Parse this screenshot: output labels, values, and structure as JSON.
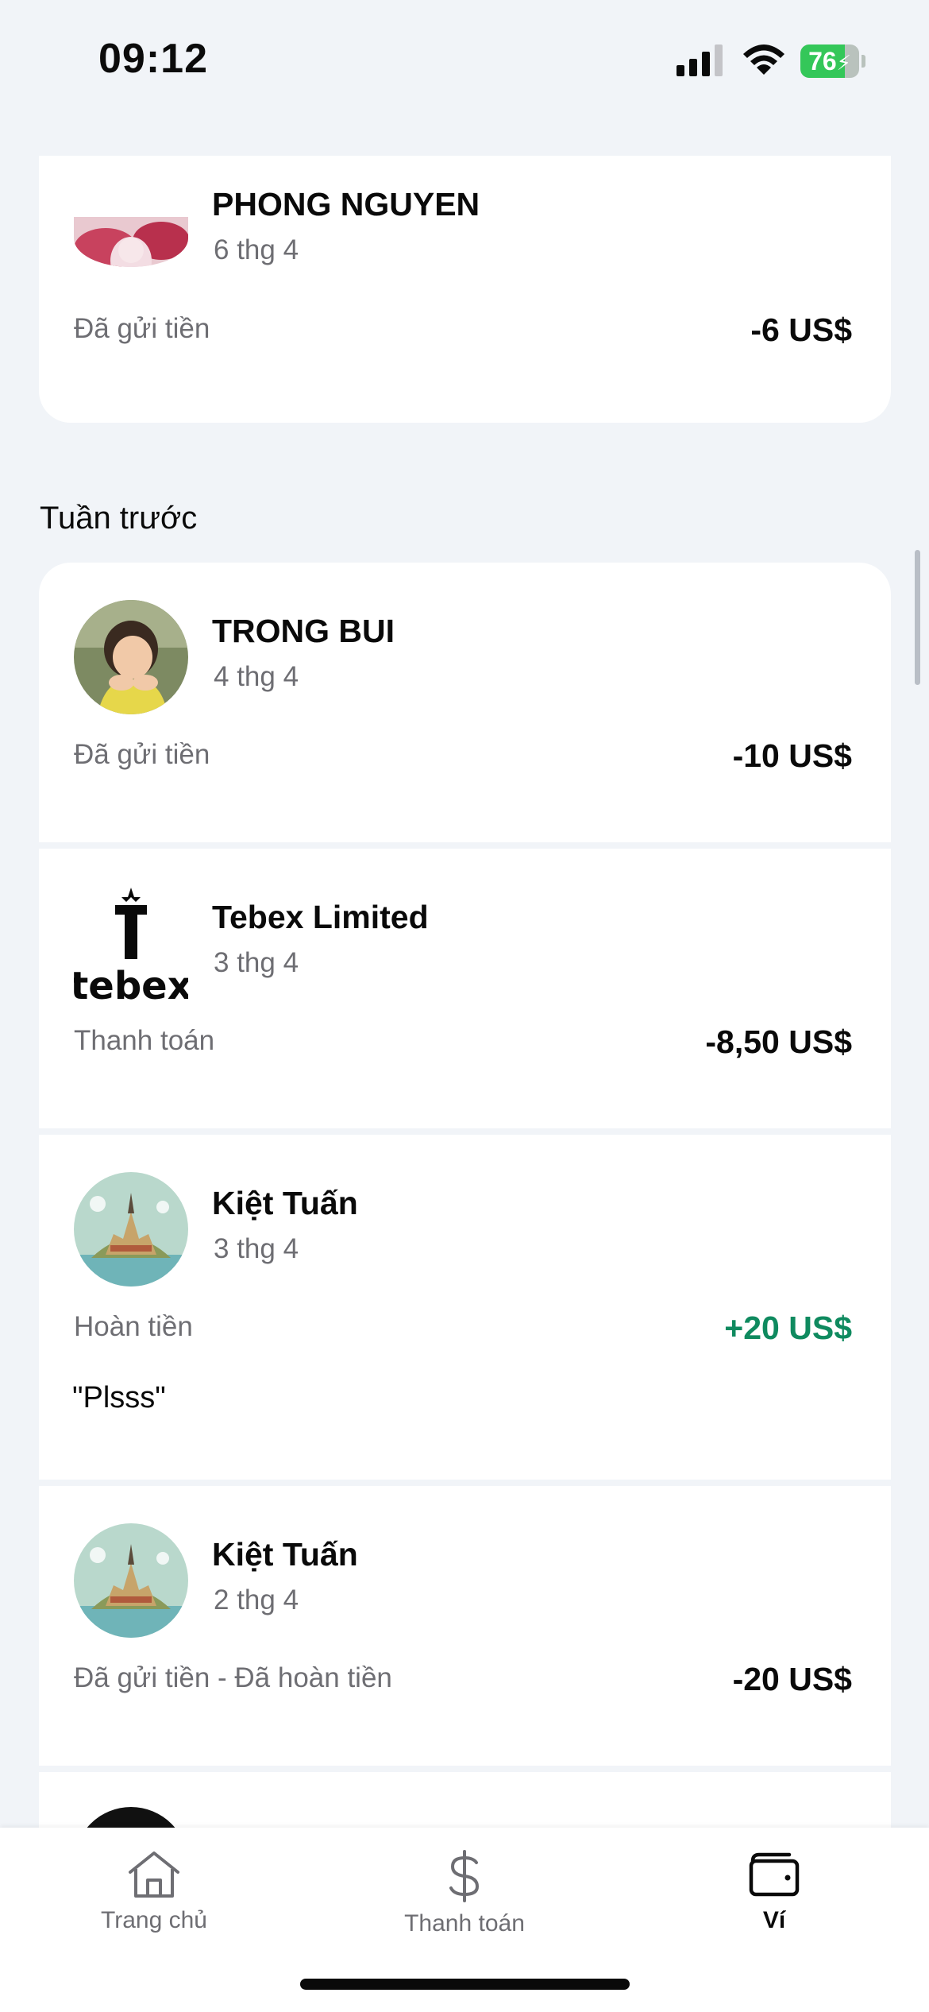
{
  "status_bar": {
    "time": "09:12",
    "battery_level": "76",
    "battery_charging": true
  },
  "section_header": "Tuần trước",
  "transactions": [
    {
      "name": "PHONG NGUYEN",
      "date": "6 thg 4",
      "type": "Đã gửi tiền",
      "amount": "-6 US$",
      "avatar": "anime-artwork-avatar"
    },
    {
      "name": "TRONG BUI",
      "date": "4 thg 4",
      "type": "Đã gửi tiền",
      "amount": "-10 US$",
      "avatar": "child-photo-avatar"
    },
    {
      "name": "Tebex Limited",
      "date": "3 thg 4",
      "type": "Thanh toán",
      "amount": "-8,50 US$",
      "avatar": "tebex-logo"
    },
    {
      "name": "Kiệt Tuấn",
      "date": "3 thg 4",
      "type": "Hoàn tiền",
      "amount": "+20 US$",
      "note": "\"Plsss\"",
      "avatar": "castle-island-avatar"
    },
    {
      "name": "Kiệt Tuấn",
      "date": "2 thg 4",
      "type": "Đã gửi tiền - Đã hoàn tiền",
      "amount": "-20 US$",
      "avatar": "castle-island-avatar"
    }
  ],
  "tab_bar": {
    "tabs": [
      {
        "label": "Trang chủ",
        "icon": "home-icon",
        "active": false
      },
      {
        "label": "Thanh toán",
        "icon": "dollar-icon",
        "active": false
      },
      {
        "label": "Ví",
        "icon": "wallet-icon",
        "active": true
      }
    ]
  },
  "colors": {
    "background": "#f1f4f8",
    "card": "#ffffff",
    "positive": "#0f8a5f",
    "muted": "#6e6e73"
  }
}
